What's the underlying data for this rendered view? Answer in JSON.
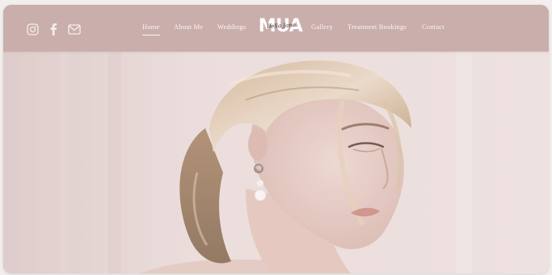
{
  "header": {
    "social": [
      {
        "name": "instagram-icon"
      },
      {
        "name": "facebook-icon"
      },
      {
        "name": "email-icon"
      }
    ],
    "nav_left": [
      "Home",
      "About Me",
      "Weddings"
    ],
    "nav_right": [
      "Gallery",
      "Treatment Bookings",
      "Contact"
    ],
    "active": "Home",
    "logo": {
      "main": "MUA",
      "script": "Bella Jane"
    }
  },
  "colors": {
    "header_bg": "#c9aeac",
    "nav_text": "#fbf6f5",
    "hero_bg": "#e7d9d6"
  }
}
